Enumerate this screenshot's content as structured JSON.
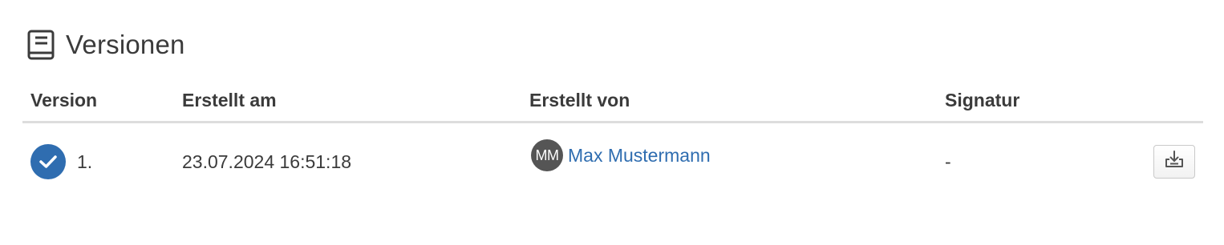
{
  "section": {
    "title": "Versionen",
    "icon": "book-icon"
  },
  "table": {
    "columns": [
      "Version",
      "Erstellt am",
      "Erstellt von",
      "Signatur"
    ],
    "rows": [
      {
        "status_icon": "check-circle-icon",
        "version": "1.",
        "created_at": "23.07.2024 16:51:18",
        "author_initials": "MM",
        "author_name": "Max Mustermann",
        "signature": "-",
        "action_icon": "download-icon"
      }
    ]
  },
  "colors": {
    "accent": "#2f6db0",
    "avatar_bg": "#555555",
    "text": "#3b3b3b",
    "divider": "#dddddd"
  }
}
